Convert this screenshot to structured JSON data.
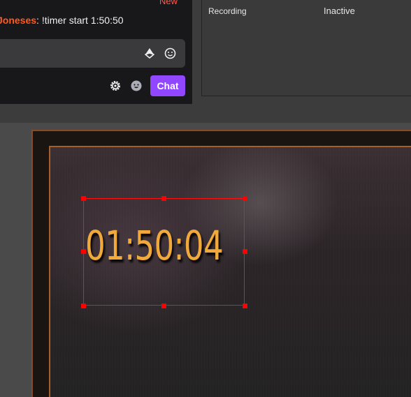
{
  "chat": {
    "new_label": "New",
    "message": {
      "username": "Joneses",
      "separator": ":",
      "text": " !timer start 1:50:50"
    },
    "icons": {
      "bits": "bits-icon",
      "emote": "emote-picker-icon",
      "settings": "gear-icon",
      "viewer": "smiley-face-icon"
    },
    "send_label": "Chat",
    "send_color": "#9147ff",
    "username_color": "#ff5a1f"
  },
  "stats": {
    "label": "Recording",
    "value": "Inactive"
  },
  "preview": {
    "timer_value": "01:50:04",
    "timer_color": "#f2a93b",
    "selection_color": "#ff0000",
    "frame_color": "#a65e2c"
  }
}
